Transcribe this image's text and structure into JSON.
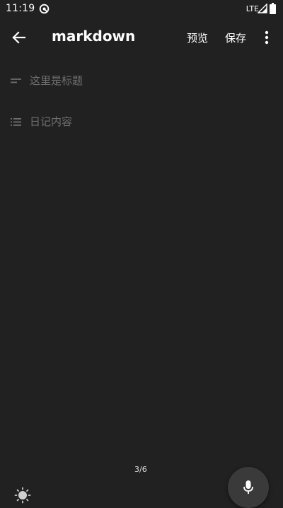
{
  "status_bar": {
    "time": "11:19",
    "network": "LTE"
  },
  "app_bar": {
    "title": "markdown",
    "preview_label": "预览",
    "save_label": "保存"
  },
  "editor": {
    "title_placeholder": "这里是标题",
    "body_placeholder": "日记内容",
    "title_icon": "short-text-icon",
    "body_icon": "list-icon"
  },
  "footer": {
    "page_counter": "3/6",
    "brightness_icon": "brightness-icon",
    "mic_icon": "microphone-icon"
  },
  "colors": {
    "background": "#212121",
    "text": "#ffffff",
    "placeholder": "#6f6f6f",
    "fab": "#3a3a3a"
  }
}
